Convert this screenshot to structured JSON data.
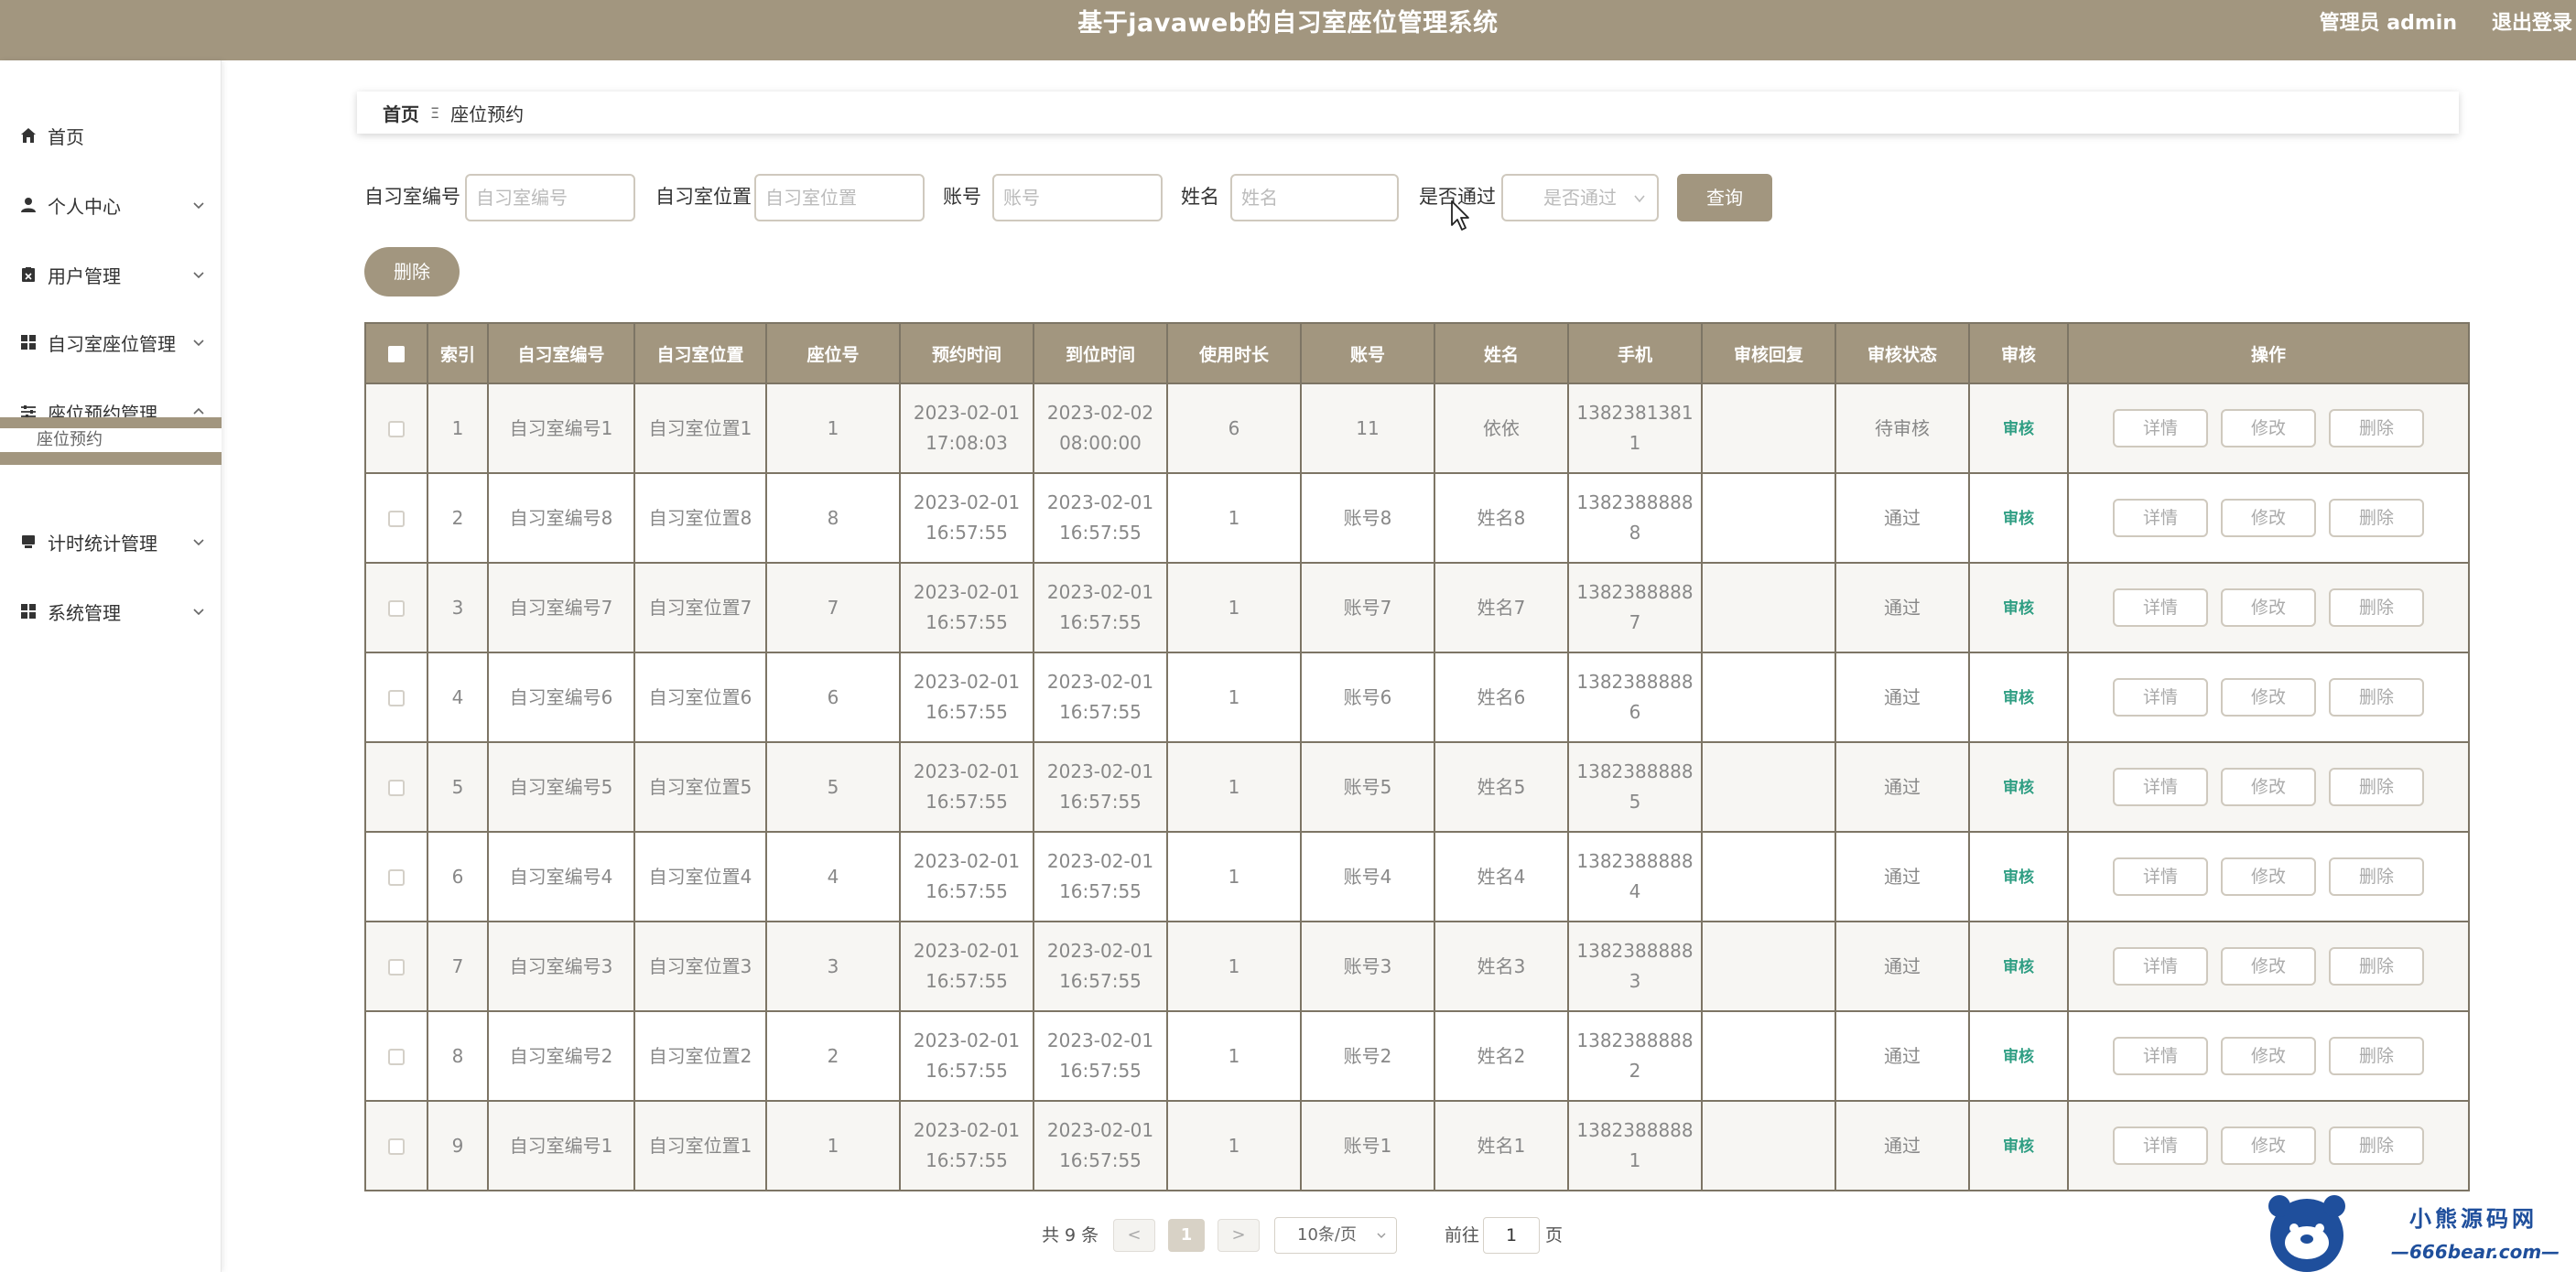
{
  "header": {
    "title": "基于javaweb的自习室座位管理系统",
    "user": "管理员 admin",
    "logout": "退出登录"
  },
  "sidebar": {
    "items": [
      {
        "label": "首页",
        "icon": "home-icon"
      },
      {
        "label": "个人中心",
        "icon": "user-icon"
      },
      {
        "label": "用户管理",
        "icon": "user-manage-icon"
      },
      {
        "label": "自习室座位管理",
        "icon": "grid-icon"
      },
      {
        "label": "座位预约管理",
        "icon": "sliders-icon"
      },
      {
        "label": "计时统计管理",
        "icon": "monitor-icon"
      },
      {
        "label": "系统管理",
        "icon": "grid-icon"
      }
    ],
    "submenu": "座位预约"
  },
  "breadcrumb": {
    "home": "首页",
    "separator": "Ξ",
    "current": "座位预约"
  },
  "search": {
    "room_no_label": "自习室编号",
    "room_no_placeholder": "自习室编号",
    "room_loc_label": "自习室位置",
    "room_loc_placeholder": "自习室位置",
    "account_label": "账号",
    "account_placeholder": "账号",
    "name_label": "姓名",
    "name_placeholder": "姓名",
    "passed_label": "是否通过",
    "passed_placeholder": "是否通过",
    "query_button": "查询",
    "delete_button": "删除"
  },
  "table": {
    "headers": [
      "索引",
      "自习室编号",
      "自习室位置",
      "座位号",
      "预约时间",
      "到位时间",
      "使用时长",
      "账号",
      "姓名",
      "手机",
      "审核回复",
      "审核状态",
      "审核",
      "操作"
    ],
    "rows": [
      {
        "index": "1",
        "room_no": "自习室编号1",
        "room_loc": "自习室位置1",
        "seat": "1",
        "reserve_date": "2023-02-01",
        "reserve_time": "17:08:03",
        "arrive_date": "2023-02-02",
        "arrive_time": "08:00:00",
        "duration": "6",
        "account": "11",
        "name": "依依",
        "phone1": "1382381381",
        "phone2": "1",
        "reply": "",
        "status": "待审核",
        "audit": "审核"
      },
      {
        "index": "2",
        "room_no": "自习室编号8",
        "room_loc": "自习室位置8",
        "seat": "8",
        "reserve_date": "2023-02-01",
        "reserve_time": "16:57:55",
        "arrive_date": "2023-02-01",
        "arrive_time": "16:57:55",
        "duration": "1",
        "account": "账号8",
        "name": "姓名8",
        "phone1": "1382388888",
        "phone2": "8",
        "reply": "",
        "status": "通过",
        "audit": "审核"
      },
      {
        "index": "3",
        "room_no": "自习室编号7",
        "room_loc": "自习室位置7",
        "seat": "7",
        "reserve_date": "2023-02-01",
        "reserve_time": "16:57:55",
        "arrive_date": "2023-02-01",
        "arrive_time": "16:57:55",
        "duration": "1",
        "account": "账号7",
        "name": "姓名7",
        "phone1": "1382388888",
        "phone2": "7",
        "reply": "",
        "status": "通过",
        "audit": "审核"
      },
      {
        "index": "4",
        "room_no": "自习室编号6",
        "room_loc": "自习室位置6",
        "seat": "6",
        "reserve_date": "2023-02-01",
        "reserve_time": "16:57:55",
        "arrive_date": "2023-02-01",
        "arrive_time": "16:57:55",
        "duration": "1",
        "account": "账号6",
        "name": "姓名6",
        "phone1": "1382388888",
        "phone2": "6",
        "reply": "",
        "status": "通过",
        "audit": "审核"
      },
      {
        "index": "5",
        "room_no": "自习室编号5",
        "room_loc": "自习室位置5",
        "seat": "5",
        "reserve_date": "2023-02-01",
        "reserve_time": "16:57:55",
        "arrive_date": "2023-02-01",
        "arrive_time": "16:57:55",
        "duration": "1",
        "account": "账号5",
        "name": "姓名5",
        "phone1": "1382388888",
        "phone2": "5",
        "reply": "",
        "status": "通过",
        "audit": "审核"
      },
      {
        "index": "6",
        "room_no": "自习室编号4",
        "room_loc": "自习室位置4",
        "seat": "4",
        "reserve_date": "2023-02-01",
        "reserve_time": "16:57:55",
        "arrive_date": "2023-02-01",
        "arrive_time": "16:57:55",
        "duration": "1",
        "account": "账号4",
        "name": "姓名4",
        "phone1": "1382388888",
        "phone2": "4",
        "reply": "",
        "status": "通过",
        "audit": "审核"
      },
      {
        "index": "7",
        "room_no": "自习室编号3",
        "room_loc": "自习室位置3",
        "seat": "3",
        "reserve_date": "2023-02-01",
        "reserve_time": "16:57:55",
        "arrive_date": "2023-02-01",
        "arrive_time": "16:57:55",
        "duration": "1",
        "account": "账号3",
        "name": "姓名3",
        "phone1": "1382388888",
        "phone2": "3",
        "reply": "",
        "status": "通过",
        "audit": "审核"
      },
      {
        "index": "8",
        "room_no": "自习室编号2",
        "room_loc": "自习室位置2",
        "seat": "2",
        "reserve_date": "2023-02-01",
        "reserve_time": "16:57:55",
        "arrive_date": "2023-02-01",
        "arrive_time": "16:57:55",
        "duration": "1",
        "account": "账号2",
        "name": "姓名2",
        "phone1": "1382388888",
        "phone2": "2",
        "reply": "",
        "status": "通过",
        "audit": "审核"
      },
      {
        "index": "9",
        "room_no": "自习室编号1",
        "room_loc": "自习室位置1",
        "seat": "1",
        "reserve_date": "2023-02-01",
        "reserve_time": "16:57:55",
        "arrive_date": "2023-02-01",
        "arrive_time": "16:57:55",
        "duration": "1",
        "account": "账号1",
        "name": "姓名1",
        "phone1": "1382388888",
        "phone2": "1",
        "reply": "",
        "status": "通过",
        "audit": "审核"
      }
    ],
    "ops": {
      "detail": "详情",
      "edit": "修改",
      "delete": "删除"
    }
  },
  "pagination": {
    "total": "共 9 条",
    "prev": "<",
    "current_page": "1",
    "next": ">",
    "page_size": "10条/页",
    "goto_label": "前往",
    "goto_value": "1",
    "page_unit": "页"
  },
  "watermark": {
    "line1": "小熊源码网",
    "line2": "—666bear.com—"
  },
  "colors": {
    "accent": "#a2967f",
    "audit_link": "#2f9e83"
  }
}
